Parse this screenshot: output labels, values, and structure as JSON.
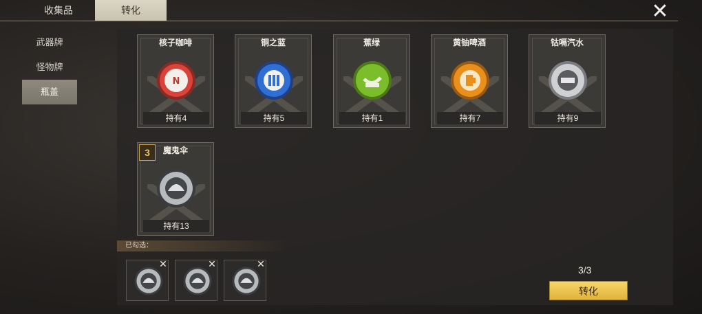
{
  "tabs": [
    "收集品",
    "转化"
  ],
  "sidebar": [
    "武器牌",
    "怪物牌",
    "瓶盖"
  ],
  "cards": [
    {
      "name": "核子咖啡",
      "hold": "持有4",
      "color": "#d9433a"
    },
    {
      "name": "铜之蓝",
      "hold": "持有5",
      "color": "#2f6fd3"
    },
    {
      "name": "蕉绿",
      "hold": "持有1",
      "color": "#7bbd2a"
    },
    {
      "name": "黄铀啤酒",
      "hold": "持有7",
      "color": "#e9901c"
    },
    {
      "name": "钴嗝汽水",
      "hold": "持有9",
      "color": "#cfd0d2"
    },
    {
      "name": "魔鬼伞",
      "hold": "持有13",
      "color": "#b8bbbe",
      "badge": "3"
    }
  ],
  "selected_label": "已勾选：",
  "count": "3/3",
  "convert_button": "转化"
}
